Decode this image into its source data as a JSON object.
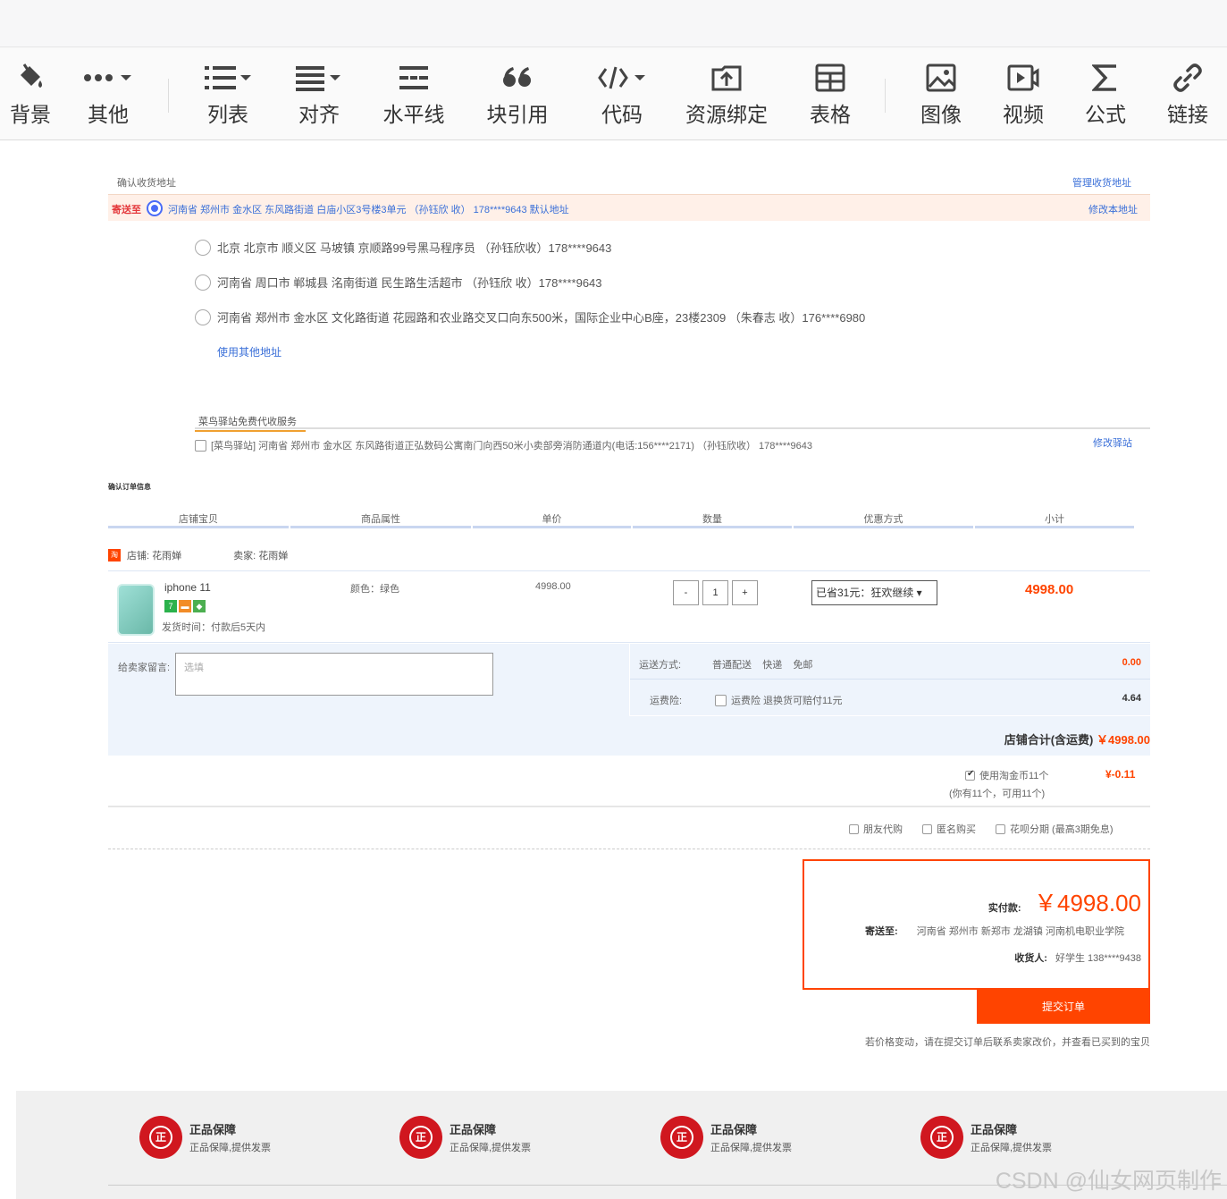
{
  "toolbar": {
    "items": [
      {
        "label": "背景",
        "icon": "paint-bucket-icon"
      },
      {
        "label": "其他",
        "icon": "more-icon"
      },
      {
        "label": "列表",
        "icon": "list-icon"
      },
      {
        "label": "对齐",
        "icon": "align-icon"
      },
      {
        "label": "水平线",
        "icon": "horizontal-line-icon"
      },
      {
        "label": "块引用",
        "icon": "quote-icon"
      },
      {
        "label": "代码",
        "icon": "code-icon"
      },
      {
        "label": "资源绑定",
        "icon": "resource-bind-icon"
      },
      {
        "label": "表格",
        "icon": "table-icon"
      },
      {
        "label": "图像",
        "icon": "image-icon"
      },
      {
        "label": "视频",
        "icon": "video-icon"
      },
      {
        "label": "公式",
        "icon": "sigma-icon"
      },
      {
        "label": "链接",
        "icon": "link-icon"
      }
    ]
  },
  "address": {
    "title": "确认收货地址",
    "manage": "管理收货地址",
    "selected_prefix": "寄送至",
    "selected": "河南省 郑州市 金水区 东风路街道 白庙小区3号楼3单元 （孙钰欣 收） 178****9643 默认地址",
    "edit": "修改本地址",
    "options": [
      "北京 北京市 顺义区 马坡镇 京顺路99号黑马程序员 （孙钰欣收）178****9643",
      "河南省 周口市 郸城县 洺南街道 民生路生活超市 （孙钰欣 收）178****9643",
      "河南省 郑州市 金水区 文化路街道 花园路和农业路交叉口向东500米，国际企业中心B座，23楼2309 （朱春志 收）176****6980"
    ],
    "use_other": "使用其他地址"
  },
  "cainiao": {
    "tab": "菜鸟驿站免费代收服务",
    "option": "[菜鸟驿站] 河南省 郑州市 金水区 东风路街道正弘数码公寓南门向西50米小卖部旁消防通道内(电话:156****2171) （孙钰欣收） 178****9643",
    "edit": "修改驿站"
  },
  "order": {
    "title": "确认订单信息",
    "headers": [
      "店铺宝贝",
      "商品属性",
      "单价",
      "数量",
      "优惠方式",
      "小计"
    ],
    "shop_icon": "淘",
    "shop": "店铺: 花雨婵",
    "seller": "卖家: 花雨婵",
    "item": {
      "name": "iphone 11",
      "badges": [
        "7",
        "▬",
        "◆"
      ],
      "ship_time": "发货时间：付款后5天内",
      "attr": "颜色：绿色",
      "price": "4998.00",
      "qty_minus": "-",
      "qty": "1",
      "qty_plus": "+",
      "promo": "已省31元：狂欢继续 ▾",
      "subtotal": "4998.00"
    }
  },
  "extras": {
    "msg_label": "给卖家留言:",
    "msg_placeholder": "选填",
    "ship_label": "运送方式:",
    "ship_methods": "普通配送    快递    免邮",
    "ship_value": "0.00",
    "ins_label": "运费险:",
    "ins_text": "运费险 退换货可赔付11元",
    "ins_value": "4.64",
    "shop_total_label": "店铺合计(含运费)",
    "shop_total": "￥4998.00"
  },
  "coins": {
    "label": "使用淘金币11个",
    "sub": "(你有11个，可用11个)",
    "value": "¥-0.11"
  },
  "options": [
    "朋友代购",
    "匿名购买",
    "花呗分期 (最高3期免息)"
  ],
  "payment": {
    "label": "实付款:",
    "amount": "￥4998.00",
    "to_label": "寄送至:",
    "to": "河南省 郑州市 新郑市 龙湖镇 河南机电职业学院",
    "recv_label": "收货人:",
    "recv": "好学生 138****9438",
    "submit": "提交订单",
    "notice": "若价格变动，请在提交订单后联系卖家改价，并查看已买到的宝贝"
  },
  "footer": {
    "seal_text": "正",
    "items": [
      {
        "title": "正品保障",
        "desc": "正品保障,提供发票"
      },
      {
        "title": "正品保障",
        "desc": "正品保障,提供发票"
      },
      {
        "title": "正品保障",
        "desc": "正品保障,提供发票"
      },
      {
        "title": "正品保障",
        "desc": "正品保障,提供发票"
      }
    ]
  },
  "watermark": "CSDN @仙女网页制作"
}
